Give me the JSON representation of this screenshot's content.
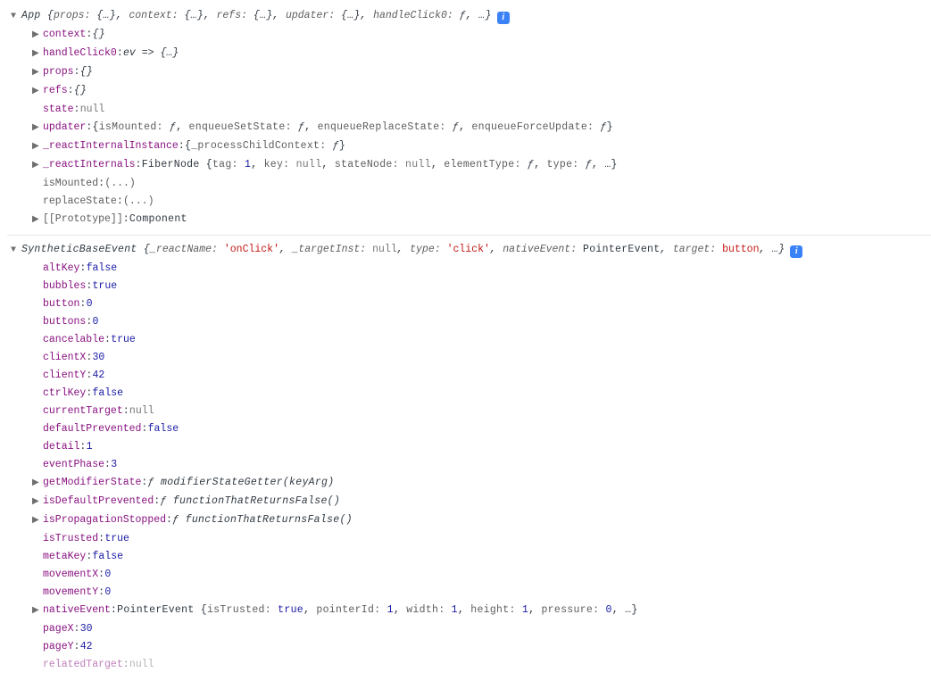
{
  "app": {
    "header": {
      "arrow": "▼",
      "class": "App",
      "preview_pairs": [
        {
          "k": "props",
          "v": "{…}",
          "t": "obj"
        },
        {
          "k": "context",
          "v": "{…}",
          "t": "obj"
        },
        {
          "k": "refs",
          "v": "{…}",
          "t": "obj"
        },
        {
          "k": "updater",
          "v": "{…}",
          "t": "obj"
        },
        {
          "k": "handleClick0",
          "v": "ƒ",
          "t": "func"
        }
      ],
      "trailing": ", …"
    },
    "rows": [
      {
        "arrow": "▶",
        "name": "context",
        "value": "{}",
        "t": "obj"
      },
      {
        "arrow": "▶",
        "name": "handleClick0",
        "value": "ev => {…}",
        "t": "italic"
      },
      {
        "arrow": "▶",
        "name": "props",
        "value": "{}",
        "t": "obj"
      },
      {
        "arrow": "▶",
        "name": "refs",
        "value": "{}",
        "t": "obj"
      },
      {
        "arrow": "",
        "name": "state",
        "value": "null",
        "t": "null"
      },
      {
        "arrow": "▶",
        "name": "updater",
        "composite": "updater_composite"
      },
      {
        "arrow": "▶",
        "name": "_reactInternalInstance",
        "composite": "rii_composite"
      },
      {
        "arrow": "▶",
        "name": "_reactInternals",
        "composite": "ri_composite"
      },
      {
        "arrow": "",
        "name": "isMounted",
        "value": "(...)",
        "t": "ellips",
        "dim": true
      },
      {
        "arrow": "",
        "name": "replaceState",
        "value": "(...)",
        "t": "ellips",
        "dim": true
      },
      {
        "arrow": "▶",
        "name": "[[Prototype]]",
        "value": "Component",
        "t": "plain",
        "hint": true
      }
    ],
    "updater_composite": {
      "pairs": [
        {
          "k": "isMounted",
          "v": "ƒ",
          "t": "func"
        },
        {
          "k": "enqueueSetState",
          "v": "ƒ",
          "t": "func"
        },
        {
          "k": "enqueueReplaceState",
          "v": "ƒ",
          "t": "func"
        },
        {
          "k": "enqueueForceUpdate",
          "v": "ƒ",
          "t": "func"
        }
      ]
    },
    "rii_composite": {
      "pairs": [
        {
          "k": "_processChildContext",
          "v": "ƒ",
          "t": "func"
        }
      ]
    },
    "ri_composite": {
      "class": "FiberNode",
      "pairs": [
        {
          "k": "tag",
          "v": "1",
          "t": "num"
        },
        {
          "k": "key",
          "v": "null",
          "t": "null"
        },
        {
          "k": "stateNode",
          "v": "null",
          "t": "null"
        },
        {
          "k": "elementType",
          "v": "ƒ",
          "t": "func"
        },
        {
          "k": "type",
          "v": "ƒ",
          "t": "func"
        }
      ],
      "trailing": ", …"
    }
  },
  "evt": {
    "header": {
      "arrow": "▼",
      "class": "SyntheticBaseEvent",
      "preview_pairs": [
        {
          "k": "_reactName",
          "v": "'onClick'",
          "t": "str"
        },
        {
          "k": "_targetInst",
          "v": "null",
          "t": "null"
        },
        {
          "k": "type",
          "v": "'click'",
          "t": "str"
        },
        {
          "k": "nativeEvent",
          "v": "PointerEvent",
          "t": "plain"
        },
        {
          "k": "target",
          "v": "button",
          "t": "str"
        }
      ],
      "trailing": ", …"
    },
    "rows": [
      {
        "arrow": "",
        "name": "altKey",
        "value": "false",
        "t": "bool"
      },
      {
        "arrow": "",
        "name": "bubbles",
        "value": "true",
        "t": "bool"
      },
      {
        "arrow": "",
        "name": "button",
        "value": "0",
        "t": "num"
      },
      {
        "arrow": "",
        "name": "buttons",
        "value": "0",
        "t": "num"
      },
      {
        "arrow": "",
        "name": "cancelable",
        "value": "true",
        "t": "bool"
      },
      {
        "arrow": "",
        "name": "clientX",
        "value": "30",
        "t": "num"
      },
      {
        "arrow": "",
        "name": "clientY",
        "value": "42",
        "t": "num"
      },
      {
        "arrow": "",
        "name": "ctrlKey",
        "value": "false",
        "t": "bool"
      },
      {
        "arrow": "",
        "name": "currentTarget",
        "value": "null",
        "t": "null"
      },
      {
        "arrow": "",
        "name": "defaultPrevented",
        "value": "false",
        "t": "bool"
      },
      {
        "arrow": "",
        "name": "detail",
        "value": "1",
        "t": "num"
      },
      {
        "arrow": "",
        "name": "eventPhase",
        "value": "3",
        "t": "num"
      },
      {
        "arrow": "▶",
        "name": "getModifierState",
        "func_sig": "modifierStateGetter(keyArg)"
      },
      {
        "arrow": "▶",
        "name": "isDefaultPrevented",
        "func_sig": "functionThatReturnsFalse()"
      },
      {
        "arrow": "▶",
        "name": "isPropagationStopped",
        "func_sig": "functionThatReturnsFalse()"
      },
      {
        "arrow": "",
        "name": "isTrusted",
        "value": "true",
        "t": "bool"
      },
      {
        "arrow": "",
        "name": "metaKey",
        "value": "false",
        "t": "bool"
      },
      {
        "arrow": "",
        "name": "movementX",
        "value": "0",
        "t": "num"
      },
      {
        "arrow": "",
        "name": "movementY",
        "value": "0",
        "t": "num"
      },
      {
        "arrow": "▶",
        "name": "nativeEvent",
        "composite": "native_composite"
      },
      {
        "arrow": "",
        "name": "pageX",
        "value": "30",
        "t": "num"
      },
      {
        "arrow": "",
        "name": "pageY",
        "value": "42",
        "t": "num"
      },
      {
        "arrow": "",
        "name": "relatedTarget",
        "value": "null",
        "t": "null",
        "cut": true
      }
    ],
    "native_composite": {
      "class": "PointerEvent",
      "pairs": [
        {
          "k": "isTrusted",
          "v": "true",
          "t": "bool"
        },
        {
          "k": "pointerId",
          "v": "1",
          "t": "num"
        },
        {
          "k": "width",
          "v": "1",
          "t": "num"
        },
        {
          "k": "height",
          "v": "1",
          "t": "num"
        },
        {
          "k": "pressure",
          "v": "0",
          "t": "num"
        }
      ],
      "trailing": ", …"
    }
  },
  "glyphs": {
    "f": "ƒ"
  }
}
